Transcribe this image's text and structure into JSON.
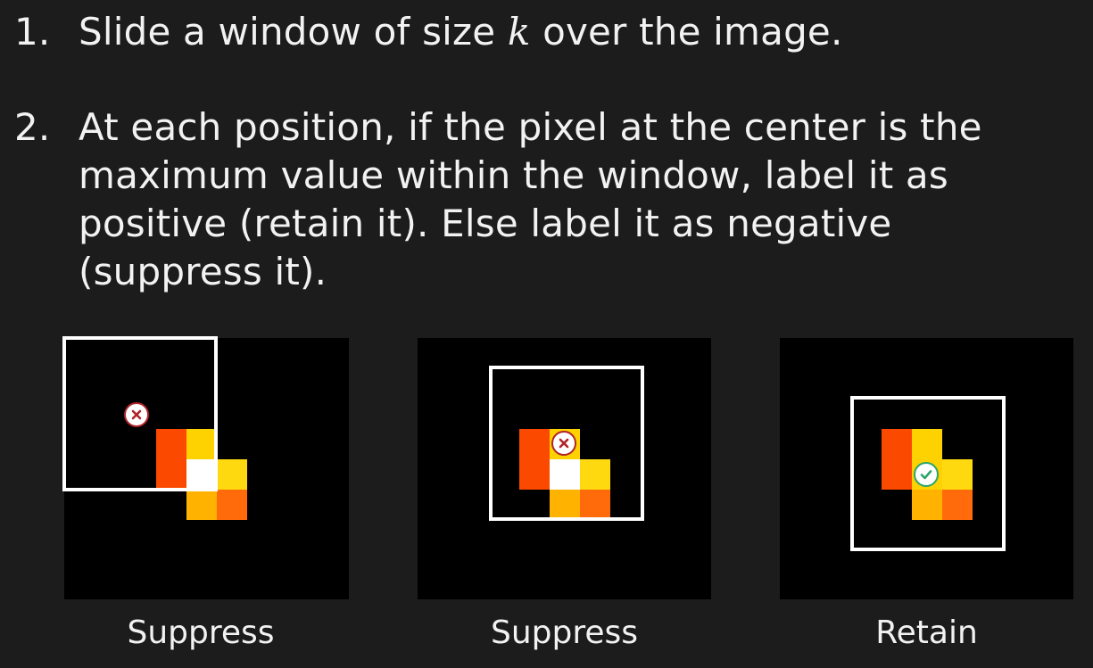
{
  "steps": [
    {
      "number": "1.",
      "text_before": "Slide a window of size ",
      "variable": "k",
      "text_after": " over the image."
    },
    {
      "number": "2.",
      "text": "At each position, if the pixel at the center is the maximum value within the window, label it as positive (retain it). Else label it as negative (suppress it)."
    }
  ],
  "panels": [
    {
      "caption": "Suppress",
      "marker": "cross-icon"
    },
    {
      "caption": "Suppress",
      "marker": "cross-icon"
    },
    {
      "caption": "Retain",
      "marker": "check-icon"
    }
  ],
  "colors": {
    "background": "#1c1c1c",
    "panel": "#000000",
    "window_border": "#ffffff",
    "pixel_orange_red": "#fb4a00",
    "pixel_yellow": "#fed100",
    "pixel_white": "#ffffff",
    "pixel_amber": "#ffb300",
    "pixel_orange": "#ff6b0a",
    "cross_marker": "#b0242a",
    "check_marker": "#2aa66b"
  }
}
